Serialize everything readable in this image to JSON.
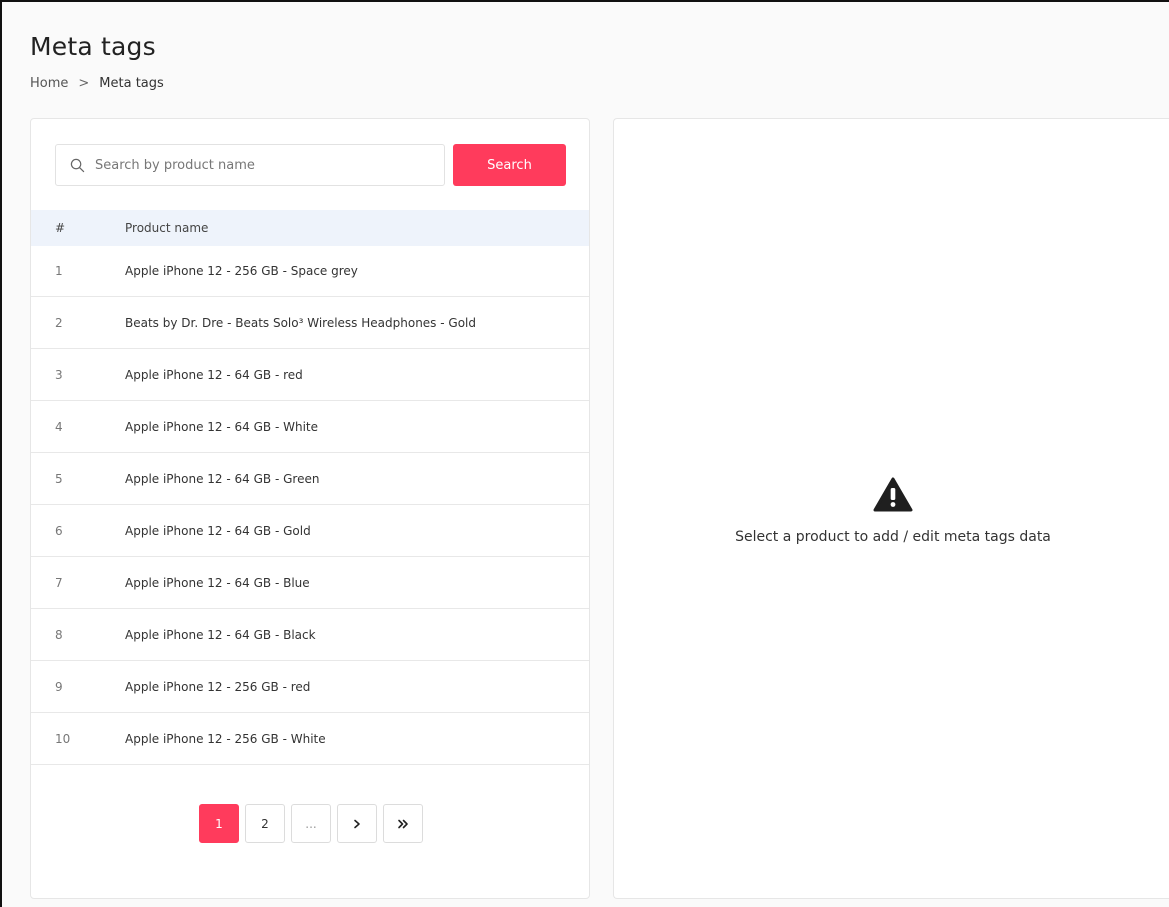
{
  "header": {
    "title": "Meta tags",
    "breadcrumb": {
      "home": "Home",
      "separator": ">",
      "current": "Meta tags"
    }
  },
  "search": {
    "placeholder": "Search by product name",
    "button_label": "Search",
    "icon": "search-icon"
  },
  "table": {
    "headers": {
      "num": "#",
      "name": "Product name"
    },
    "rows": [
      {
        "num": "1",
        "name": "Apple iPhone 12 - 256 GB - Space grey"
      },
      {
        "num": "2",
        "name": "Beats by Dr. Dre - Beats Solo³ Wireless Headphones - Gold"
      },
      {
        "num": "3",
        "name": "Apple iPhone 12 - 64 GB - red"
      },
      {
        "num": "4",
        "name": "Apple iPhone 12 - 64 GB - White"
      },
      {
        "num": "5",
        "name": "Apple iPhone 12 - 64 GB - Green"
      },
      {
        "num": "6",
        "name": "Apple iPhone 12 - 64 GB - Gold"
      },
      {
        "num": "7",
        "name": "Apple iPhone 12 - 64 GB - Blue"
      },
      {
        "num": "8",
        "name": "Apple iPhone 12 - 64 GB - Black"
      },
      {
        "num": "9",
        "name": "Apple iPhone 12 - 256 GB - red"
      },
      {
        "num": "10",
        "name": "Apple iPhone 12 - 256 GB - White"
      }
    ]
  },
  "pagination": {
    "pages": [
      "1",
      "2",
      "..."
    ],
    "active_page": "1",
    "next_label": "›",
    "last_label": "»"
  },
  "empty_state": {
    "icon": "warning-icon",
    "message": "Select a product to add / edit meta tags data"
  },
  "colors": {
    "accent": "#ff3b5c",
    "table_header_bg": "#eef3fb"
  }
}
